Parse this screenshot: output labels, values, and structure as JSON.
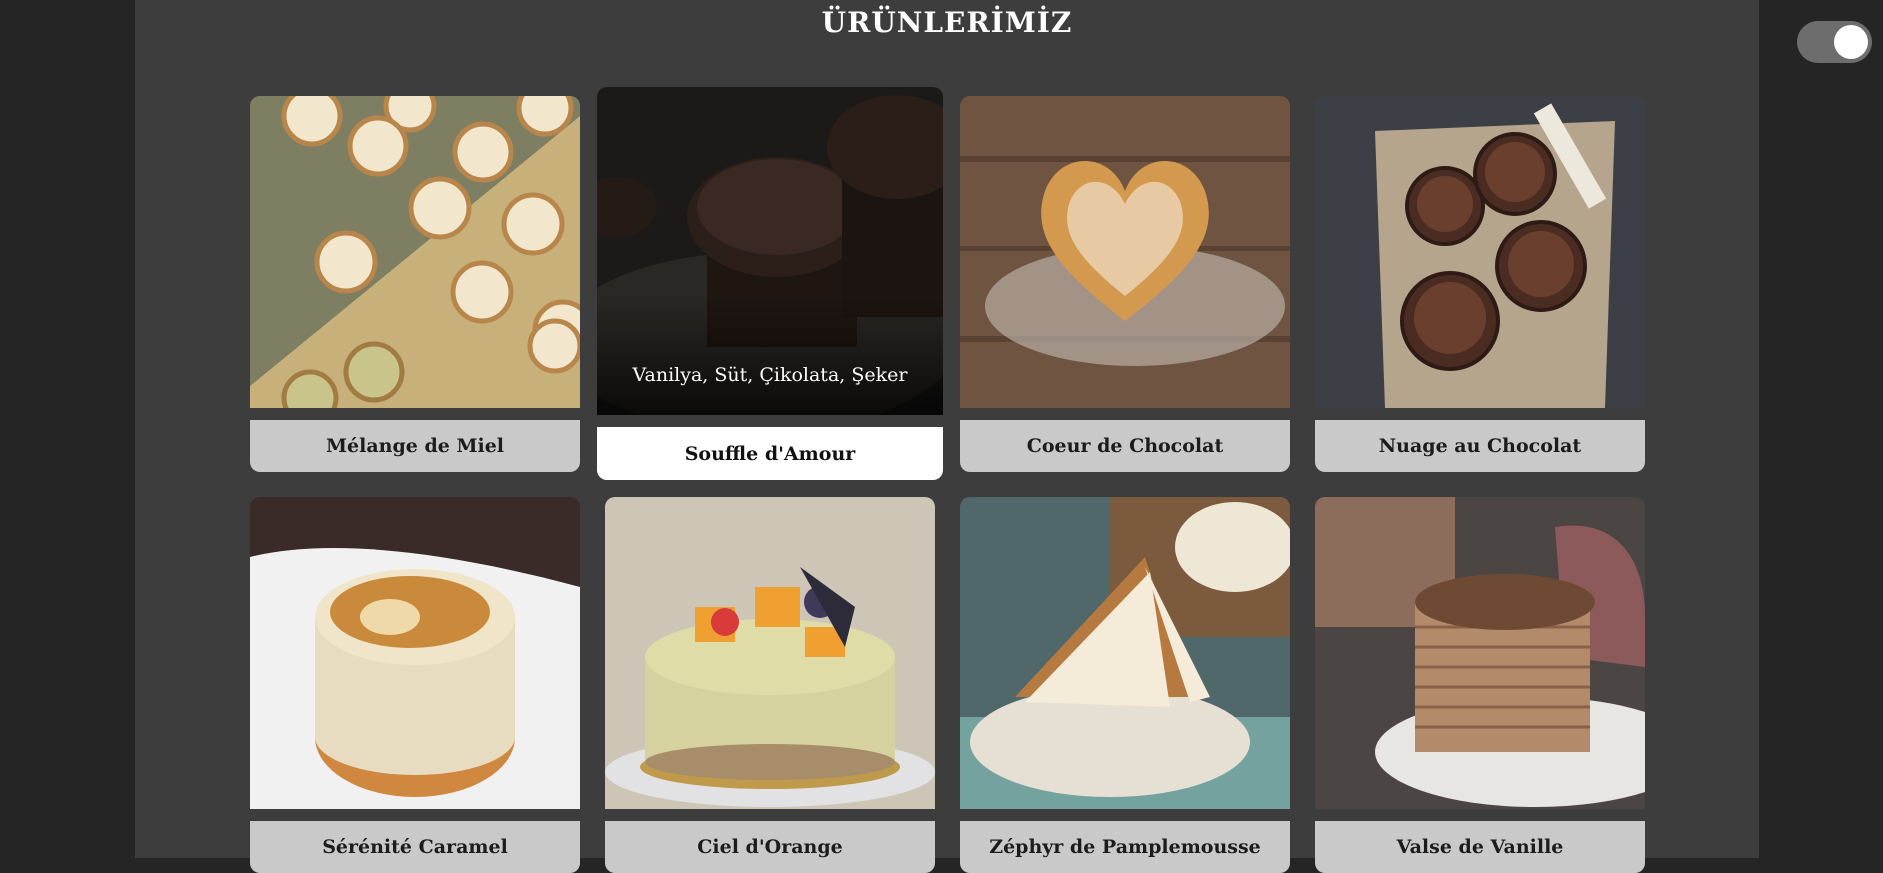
{
  "page": {
    "title": "ÜRÜNLERİMİZ"
  },
  "theme_toggle": {
    "state": "on"
  },
  "products": [
    {
      "name": "Mélange de Miel",
      "image_icon": "honey-tartlets-image"
    },
    {
      "name": "Souffle d'Amour",
      "image_icon": "chocolate-souffle-image",
      "hover_ingredients": "Vanilya, Süt, Çikolata, Şeker"
    },
    {
      "name": "Coeur de Chocolat",
      "image_icon": "heart-pastry-image"
    },
    {
      "name": "Nuage au Chocolat",
      "image_icon": "chocolate-cakes-image"
    },
    {
      "name": "Sérénité Caramel",
      "image_icon": "caramel-tart-image"
    },
    {
      "name": "Ciel d'Orange",
      "image_icon": "fruit-cheesecake-image"
    },
    {
      "name": "Zéphyr de Pamplemousse",
      "image_icon": "carrot-cake-image"
    },
    {
      "name": "Valse de Vanille",
      "image_icon": "crepe-cake-image"
    }
  ],
  "colors": {
    "background": "#252525",
    "panel": "#3d3d3e",
    "label": "#c9c9c9",
    "label_active": "#ffffff"
  }
}
